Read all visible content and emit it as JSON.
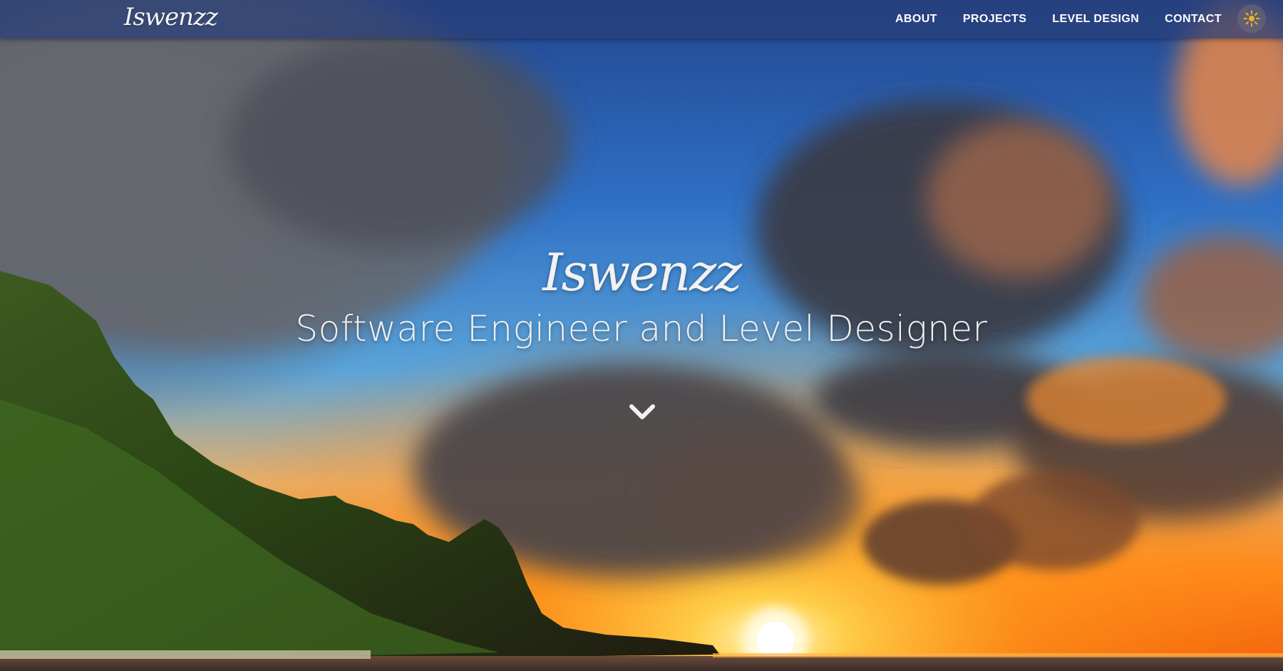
{
  "navbar": {
    "brand": "Iswenzz",
    "links": [
      {
        "label": "ABOUT"
      },
      {
        "label": "PROJECTS"
      },
      {
        "label": "LEVEL DESIGN"
      },
      {
        "label": "CONTACT"
      }
    ],
    "theme_toggle_icon": "sun-icon"
  },
  "hero": {
    "title": "Iswenzz",
    "subtitle": "Software Engineer and Level Designer",
    "scroll_icon": "chevron-down-icon"
  },
  "colors": {
    "navbar_bg": "#283e78",
    "accent_sun": "#f2b01e",
    "text": "#ffffff"
  }
}
